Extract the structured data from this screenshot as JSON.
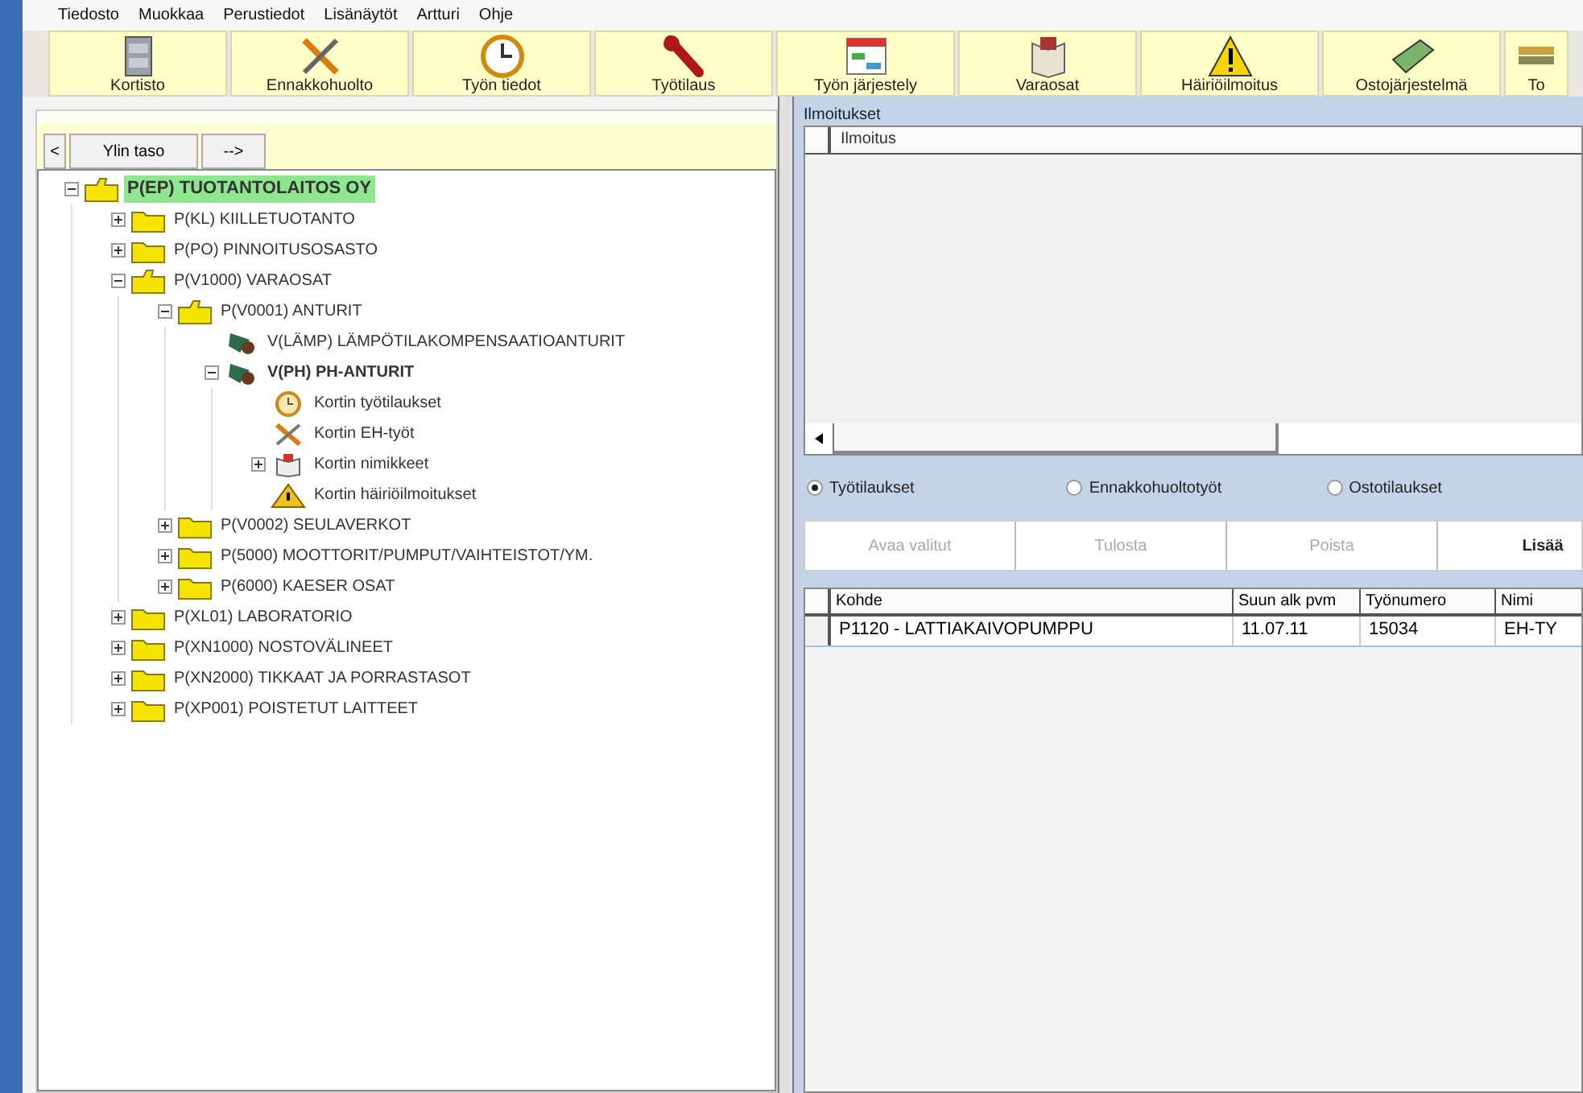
{
  "menu": [
    "Tiedosto",
    "Muokkaa",
    "Perustiedot",
    "Lisänäytöt",
    "Artturi",
    "Ohje"
  ],
  "toolbar": [
    {
      "label": "Kortisto",
      "kind": "cabinet"
    },
    {
      "label": "Ennakkohuolto",
      "kind": "tools"
    },
    {
      "label": "Työn tiedot",
      "kind": "clock"
    },
    {
      "label": "Työtilaus",
      "kind": "wrench"
    },
    {
      "label": "Työn järjestely",
      "kind": "calendar"
    },
    {
      "label": "Varaosat",
      "kind": "book"
    },
    {
      "label": "Häiriöilmoitus",
      "kind": "warning"
    },
    {
      "label": "Ostojärjestelmä",
      "kind": "money"
    },
    {
      "label": "To",
      "kind": "stack"
    }
  ],
  "nav": {
    "back": "<",
    "top": "Ylin taso",
    "forward": "-->"
  },
  "tree": [
    {
      "label": "P(EP) TUOTANTOLAITOS OY",
      "kind": "folder",
      "expanded": true,
      "selected": true,
      "children": [
        {
          "label": "P(KL) KIILLETUOTANTO",
          "kind": "folder",
          "expanded": false,
          "selected": false
        },
        {
          "label": "P(PO) PINNOITUSOSASTO",
          "kind": "folder",
          "expanded": false,
          "selected": false
        },
        {
          "label": "P(V1000) VARAOSAT",
          "kind": "folder",
          "expanded": true,
          "selected": false,
          "children": [
            {
              "label": "P(V0001) ANTURIT",
              "kind": "folder",
              "expanded": true,
              "selected": false,
              "children": [
                {
                  "label": "V(LÄMP) LÄMPÖTILAKOMPENSAATIOANTURIT",
                  "kind": "device",
                  "selected": false
                },
                {
                  "label": "V(PH) PH-ANTURIT",
                  "kind": "device",
                  "expanded": true,
                  "selected": false,
                  "children": [
                    {
                      "label": "Kortin työtilaukset",
                      "kind": "orders",
                      "selected": false
                    },
                    {
                      "label": "Kortin EH-työt",
                      "kind": "maintenance",
                      "selected": false
                    },
                    {
                      "label": "Kortin nimikkeet",
                      "kind": "items",
                      "expanded": false,
                      "selected": false
                    },
                    {
                      "label": "Kortin häiriöilmoitukset",
                      "kind": "warning",
                      "selected": false
                    }
                  ]
                }
              ]
            },
            {
              "label": "P(V0002) SEULAVERKOT",
              "kind": "folder",
              "expanded": false,
              "selected": false
            },
            {
              "label": "P(5000) MOOTTORIT/PUMPUT/VAIHTEISTOT/YM.",
              "kind": "folder",
              "expanded": false,
              "selected": false
            },
            {
              "label": "P(6000) KAESER OSAT",
              "kind": "folder",
              "expanded": false,
              "selected": false
            }
          ]
        },
        {
          "label": "P(XL01) LABORATORIO",
          "kind": "folder",
          "expanded": false,
          "selected": false
        },
        {
          "label": "P(XN1000) NOSTOVÄLINEET",
          "kind": "folder",
          "expanded": false,
          "selected": false
        },
        {
          "label": "P(XN2000) TIKKAAT JA PORRASTASOT",
          "kind": "folder",
          "expanded": false,
          "selected": false
        },
        {
          "label": "P(XP001) POISTETUT LAITTEET",
          "kind": "folder",
          "expanded": false,
          "selected": false
        }
      ]
    }
  ],
  "notices": {
    "title": "Ilmoitukset",
    "columns": [
      "Ilmoitus"
    ]
  },
  "radios": [
    {
      "label": "Työtilaukset",
      "selected": true
    },
    {
      "label": "Ennakkohuoltotyöt",
      "selected": false
    },
    {
      "label": "Ostotilaukset",
      "selected": false
    }
  ],
  "actions": [
    {
      "label": "Avaa valitut",
      "disabled": true
    },
    {
      "label": "Tulosta",
      "disabled": true
    },
    {
      "label": "Poista",
      "disabled": true
    },
    {
      "label": "Lisää",
      "disabled": false
    }
  ],
  "orders": {
    "columns": [
      "Kohde",
      "Suun alk pvm",
      "Työnumero",
      "Nimi"
    ],
    "rows": [
      [
        "P1120 - LATTIAKAIVOPUMPPU",
        "11.07.11",
        "15034",
        "EH-TY"
      ]
    ]
  }
}
